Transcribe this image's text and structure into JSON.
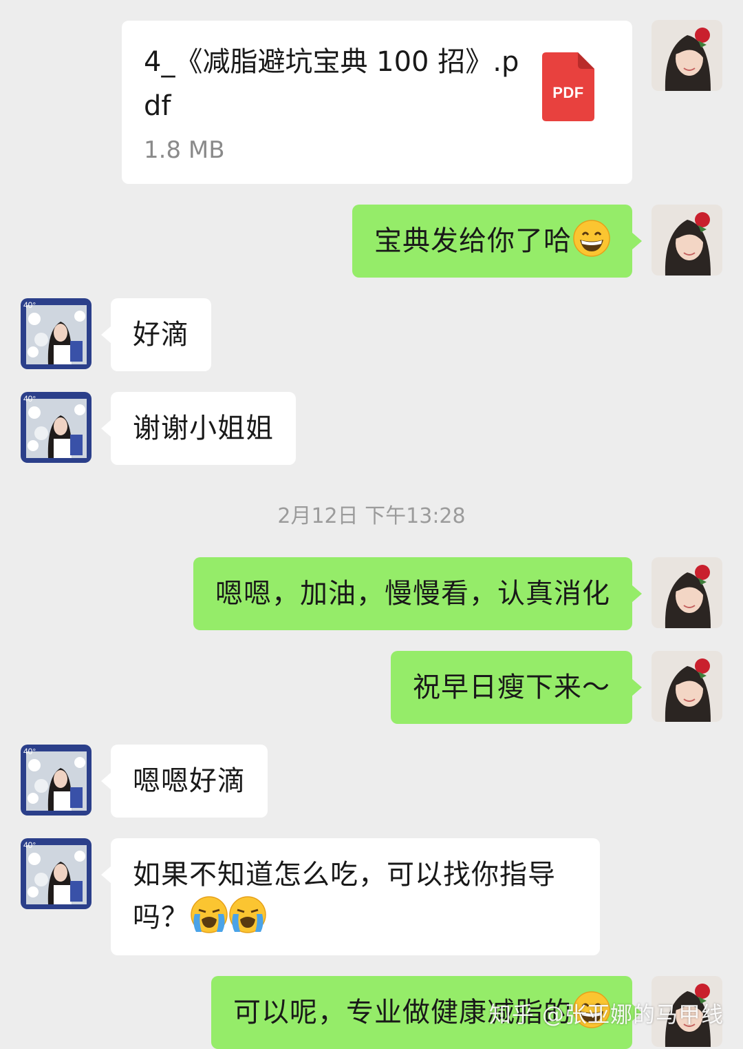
{
  "file_message": {
    "file_name": "4_《减脂避坑宝典 100 招》.pdf",
    "file_size": "1.8 MB",
    "file_type_label": "PDF",
    "icon": "pdf-file-icon"
  },
  "messages": [
    {
      "sender": "me",
      "text": "宝典发给你了哈",
      "emoji": "grinning-face-emoji"
    },
    {
      "sender": "them",
      "text": "好滴"
    },
    {
      "sender": "them",
      "text": "谢谢小姐姐"
    },
    {
      "sender": "me",
      "text": "嗯嗯，加油，慢慢看，认真消化"
    },
    {
      "sender": "me",
      "text": "祝早日瘦下来～"
    },
    {
      "sender": "them",
      "text": "嗯嗯好滴"
    },
    {
      "sender": "them",
      "text_line1": "如果不知道怎么吃，可以找你指导",
      "text_line2": "吗？",
      "emoji": "loudly-crying-face-emoji x2"
    },
    {
      "sender": "me",
      "text": "可以呢，专业做健康减脂的",
      "emoji": "grinning-face-emoji"
    }
  ],
  "timestamp": "2月12日 下午13:28",
  "avatar_badge": "40",
  "watermark": "知乎 @张亚娜的马甲线",
  "colors": {
    "background": "#ededed",
    "my_bubble": "#95ec69",
    "their_bubble": "#ffffff",
    "pdf_red": "#e8413e"
  }
}
